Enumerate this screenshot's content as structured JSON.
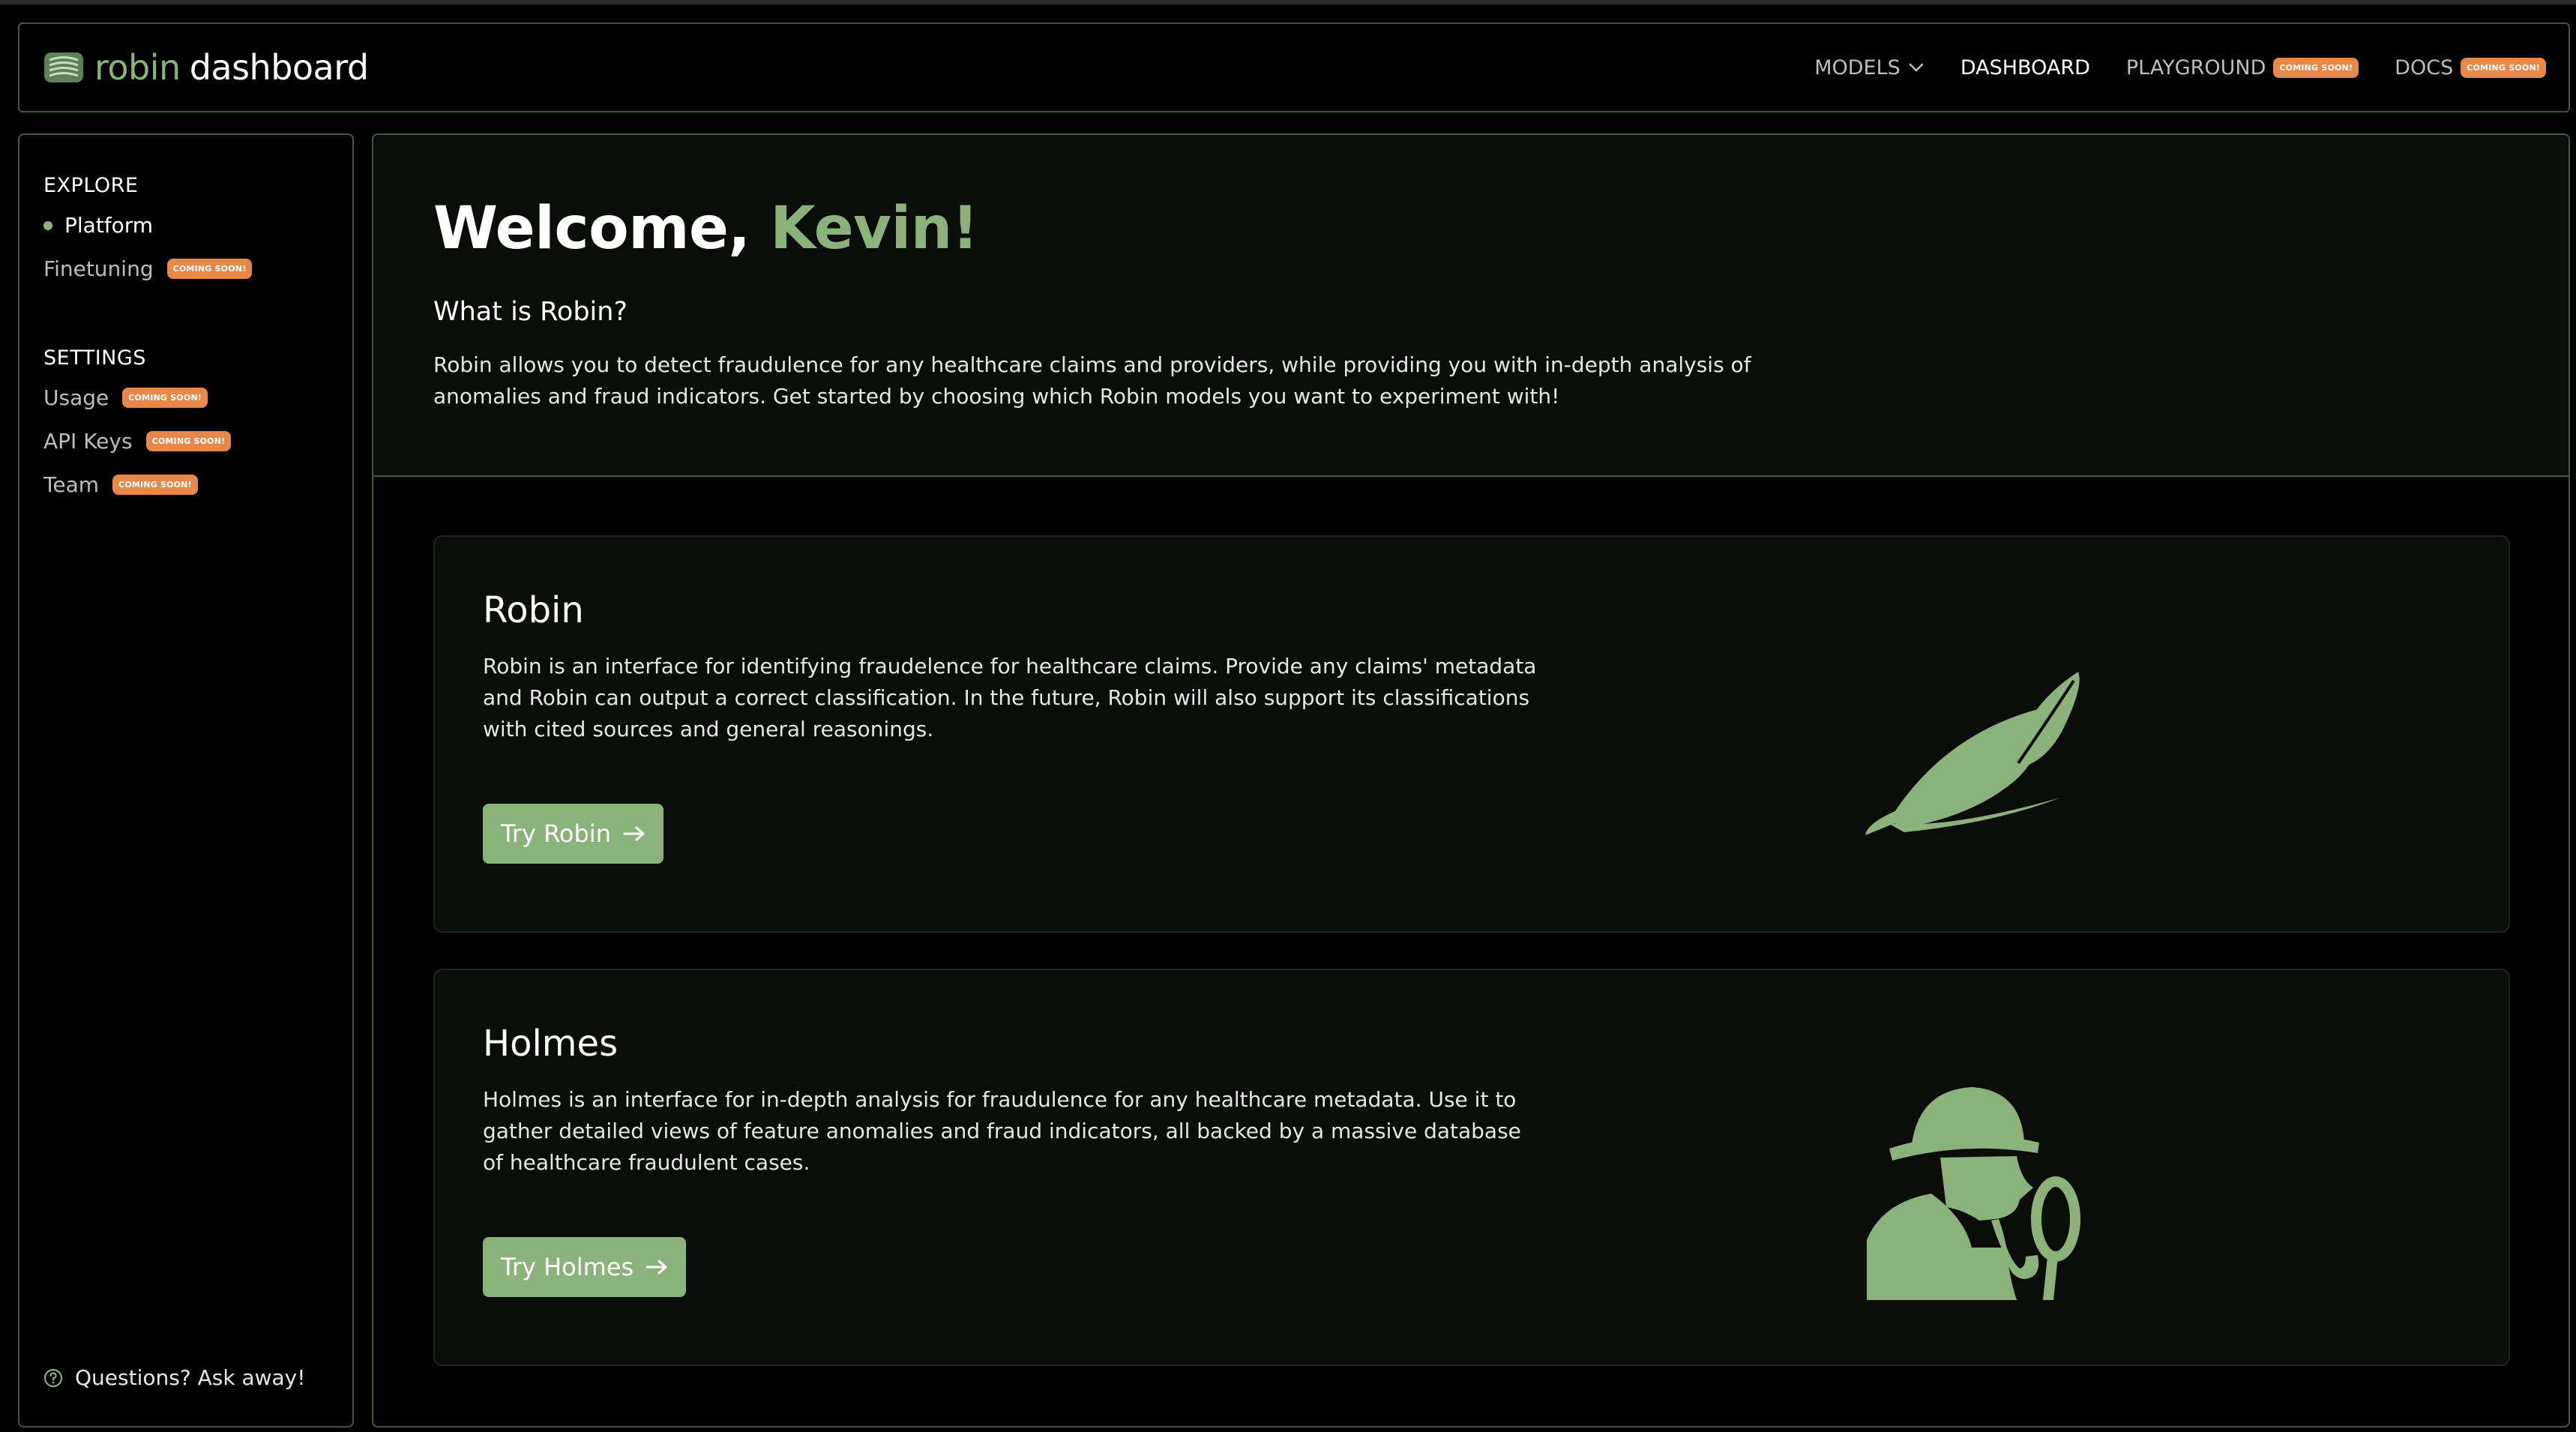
{
  "app": {
    "brand_robin": "robin",
    "brand_dashboard": "dashboard"
  },
  "nav": {
    "models": "MODELS",
    "dashboard": "DASHBOARD",
    "playground": "PLAYGROUND",
    "docs": "DOCS",
    "coming_soon": "COMING SOON!"
  },
  "sidebar": {
    "explore_heading": "EXPLORE",
    "settings_heading": "SETTINGS",
    "items": {
      "platform": "Platform",
      "finetuning": "Finetuning",
      "usage": "Usage",
      "api_keys": "API Keys",
      "team": "Team"
    },
    "help": "Questions? Ask away!"
  },
  "main": {
    "welcome_prefix": "Welcome, ",
    "welcome_name": "Kevin!",
    "subhead": "What is Robin?",
    "intro": "Robin allows you to detect fraudulence for any healthcare claims and providers, while providing you with in-depth analysis of anomalies and fraud indicators. Get started by choosing which Robin models you want to experiment with!",
    "cards": [
      {
        "title": "Robin",
        "description": "Robin is an interface for identifying fraudelence for healthcare claims. Provide any claims' metadata and Robin can output a correct classification. In the future, Robin will also support its classifications with cited sources and general reasonings.",
        "button": "Try Robin",
        "icon": "feathered-hat-icon"
      },
      {
        "title": "Holmes",
        "description": "Holmes is an interface for in-depth analysis for fraudulence for any healthcare metadata. Use it to gather detailed views of feature anomalies and fraud indicators, all backed by a massive database of healthcare fraudulent cases.",
        "button": "Try Holmes",
        "icon": "detective-magnifier-icon"
      }
    ]
  },
  "colors": {
    "accent_green": "#8bb27b",
    "badge_orange": "#e8894a",
    "border_green": "#3f5a41",
    "panel_bg": "#0b0d0b"
  }
}
